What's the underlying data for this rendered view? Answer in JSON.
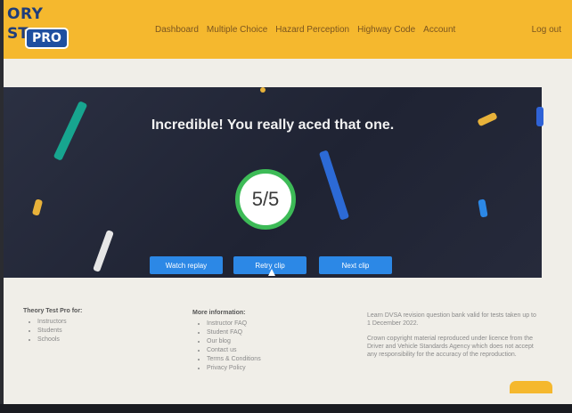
{
  "header": {
    "logo_line1": "ORY",
    "logo_line2": "ST",
    "logo_badge": "PRO",
    "nav": [
      "Dashboard",
      "Multiple Choice",
      "Hazard Perception",
      "Highway Code",
      "Account"
    ],
    "logout": "Log out",
    "brand_color": "#f5b82e"
  },
  "result": {
    "heading": "Incredible! You really aced that one.",
    "score": "5/5",
    "ring_color": "#3dbb57",
    "buttons": {
      "watch": "Watch replay",
      "retry": "Retry clip",
      "next": "Next clip"
    },
    "button_color": "#2c88e6"
  },
  "footer": {
    "col1": {
      "title": "Theory Test Pro for:",
      "items": [
        "Instructors",
        "Students",
        "Schools"
      ]
    },
    "col2": {
      "title": "More information:",
      "items": [
        "Instructor FAQ",
        "Student FAQ",
        "Our blog",
        "Contact us",
        "Terms & Conditions",
        "Privacy Policy"
      ]
    },
    "col3": {
      "p1": "Learn DVSA revision question bank valid for tests taken up to 1 December 2022.",
      "p2": "Crown copyright material reproduced under licence from the Driver and Vehicle Standards Agency which does not accept any responsibility for the accuracy of the reproduction."
    }
  }
}
